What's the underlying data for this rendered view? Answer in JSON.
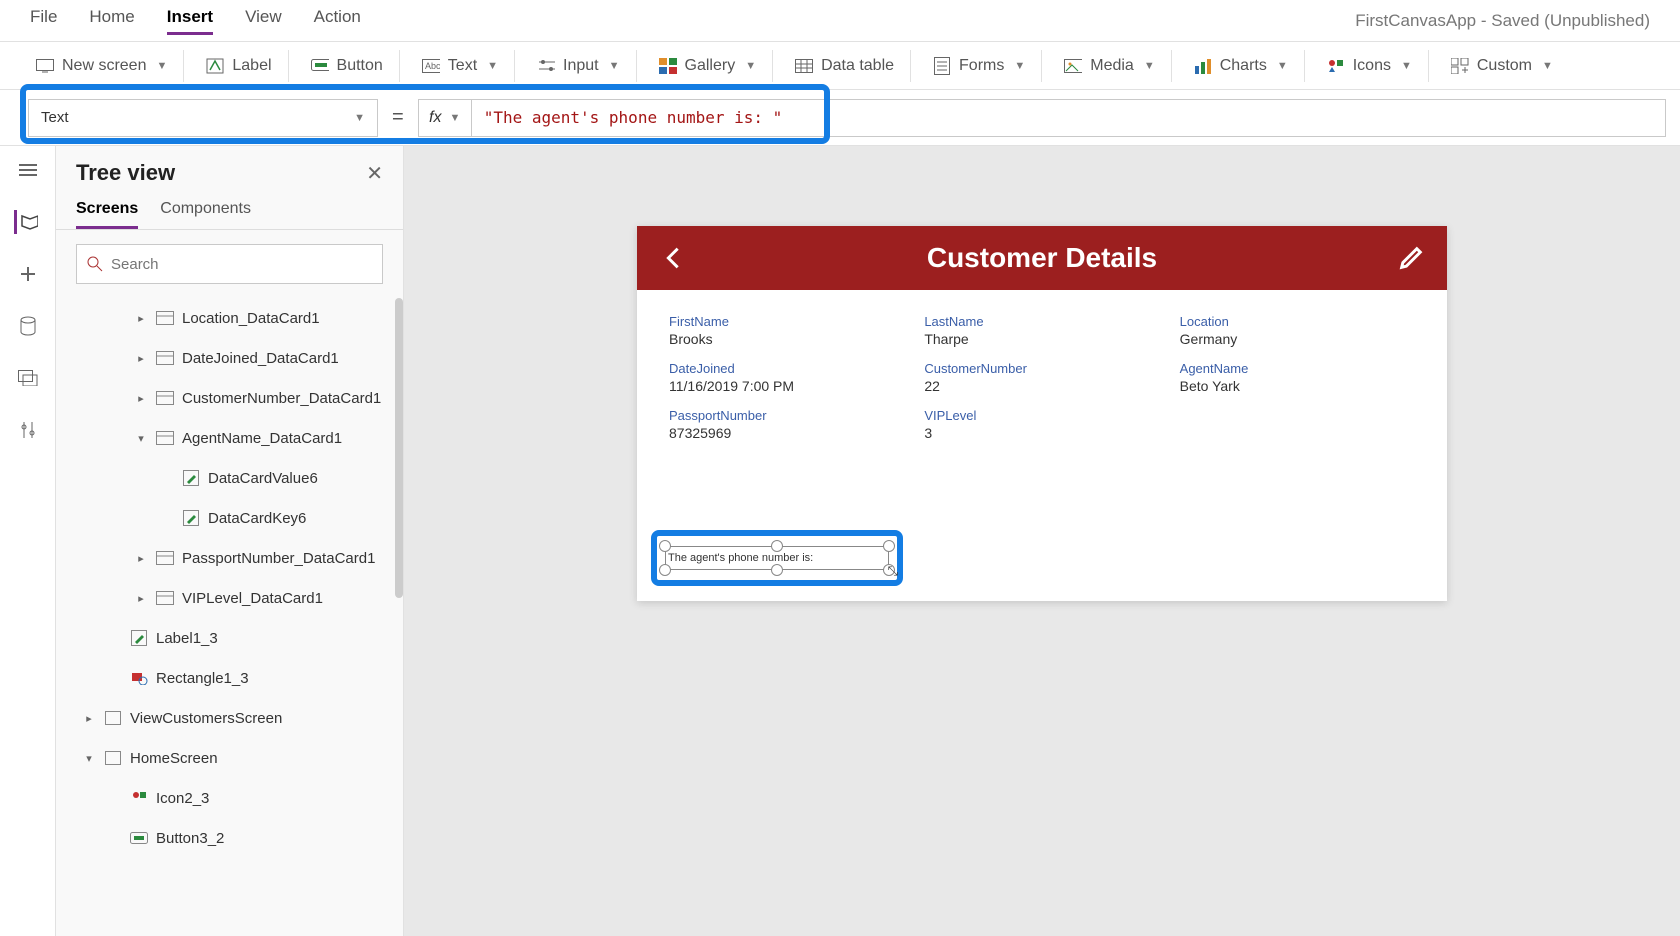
{
  "menu": {
    "file": "File",
    "home": "Home",
    "insert": "Insert",
    "view": "View",
    "action": "Action"
  },
  "status": "FirstCanvasApp - Saved (Unpublished)",
  "ribbon": {
    "newscreen": "New screen",
    "label": "Label",
    "button": "Button",
    "text": "Text",
    "input": "Input",
    "gallery": "Gallery",
    "datatable": "Data table",
    "forms": "Forms",
    "media": "Media",
    "charts": "Charts",
    "icons": "Icons",
    "custom": "Custom"
  },
  "formula": {
    "property": "Text",
    "equals": "=",
    "fx": "fx",
    "value": "\"The agent's phone number is: \""
  },
  "tree": {
    "title": "Tree view",
    "tabs": {
      "screens": "Screens",
      "components": "Components"
    },
    "search_placeholder": "Search",
    "nodes": [
      {
        "indent": 2,
        "caret": ">",
        "icon": "card",
        "label": "Location_DataCard1"
      },
      {
        "indent": 2,
        "caret": ">",
        "icon": "card",
        "label": "DateJoined_DataCard1"
      },
      {
        "indent": 2,
        "caret": ">",
        "icon": "card",
        "label": "CustomerNumber_DataCard1"
      },
      {
        "indent": 2,
        "caret": "v",
        "icon": "card",
        "label": "AgentName_DataCard1"
      },
      {
        "indent": 3,
        "caret": "",
        "icon": "edit",
        "label": "DataCardValue6"
      },
      {
        "indent": 3,
        "caret": "",
        "icon": "edit",
        "label": "DataCardKey6"
      },
      {
        "indent": 2,
        "caret": ">",
        "icon": "card",
        "label": "PassportNumber_DataCard1"
      },
      {
        "indent": 2,
        "caret": ">",
        "icon": "card",
        "label": "VIPLevel_DataCard1"
      },
      {
        "indent": 1,
        "caret": "",
        "icon": "edit",
        "label": "Label1_3"
      },
      {
        "indent": 1,
        "caret": "",
        "icon": "shape",
        "label": "Rectangle1_3"
      },
      {
        "indent": 0,
        "caret": ">",
        "icon": "screen",
        "label": "ViewCustomersScreen"
      },
      {
        "indent": 0,
        "caret": "v",
        "icon": "screen",
        "label": "HomeScreen"
      },
      {
        "indent": 1,
        "caret": "",
        "icon": "iconc",
        "label": "Icon2_3"
      },
      {
        "indent": 1,
        "caret": "",
        "icon": "btn",
        "label": "Button3_2"
      }
    ]
  },
  "app": {
    "title": "Customer Details",
    "fields": [
      {
        "label": "FirstName",
        "value": "Brooks"
      },
      {
        "label": "LastName",
        "value": "Tharpe"
      },
      {
        "label": "Location",
        "value": "Germany"
      },
      {
        "label": "DateJoined",
        "value": "11/16/2019 7:00 PM"
      },
      {
        "label": "CustomerNumber",
        "value": "22"
      },
      {
        "label": "AgentName",
        "value": "Beto Yark"
      },
      {
        "label": "PassportNumber",
        "value": "87325969"
      },
      {
        "label": "VIPLevel",
        "value": "3"
      }
    ],
    "selected_label_text": "The agent's phone number is:"
  }
}
